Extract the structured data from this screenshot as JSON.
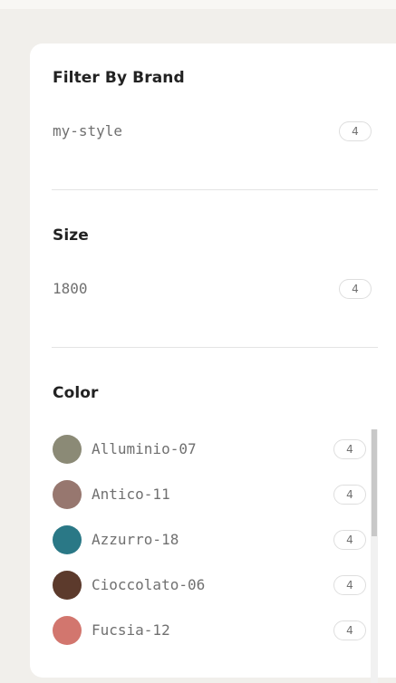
{
  "brand": {
    "title": "Filter By Brand",
    "items": [
      {
        "label": "my-style",
        "count": "4"
      }
    ]
  },
  "size": {
    "title": "Size",
    "items": [
      {
        "label": "1800",
        "count": "4"
      }
    ]
  },
  "color": {
    "title": "Color",
    "items": [
      {
        "label": "Alluminio-07",
        "count": "4",
        "swatch": "#8b8a76"
      },
      {
        "label": "Antico-11",
        "count": "4",
        "swatch": "#97776f"
      },
      {
        "label": "Azzurro-18",
        "count": "4",
        "swatch": "#2a7886"
      },
      {
        "label": "Cioccolato-06",
        "count": "4",
        "swatch": "#5c3a2c"
      },
      {
        "label": "Fucsia-12",
        "count": "4",
        "swatch": "#d2766e"
      }
    ]
  },
  "colors": {
    "page_background": "#f1efeb",
    "panel_background": "#ffffff",
    "title_text": "#222222",
    "body_text": "#707070"
  }
}
